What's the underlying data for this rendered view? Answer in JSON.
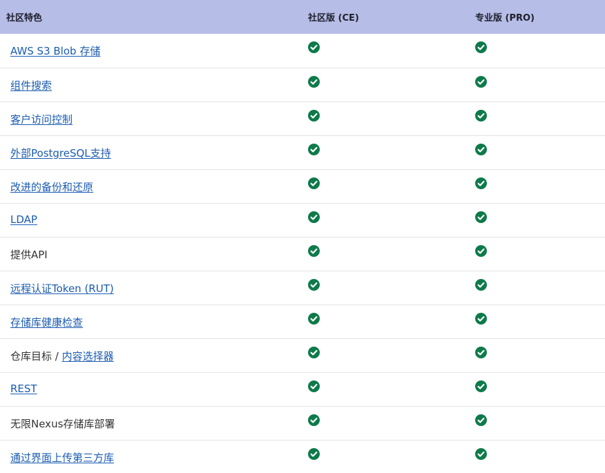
{
  "header": {
    "feature": "社区特色",
    "ce": "社区版 (CE)",
    "pro": "专业版 (PRO)"
  },
  "colors": {
    "header_bg": "#b6bde6",
    "link": "#1a5bb0",
    "check": "#0e7a4a"
  },
  "rows": [
    {
      "parts": [
        {
          "text": "AWS S3 Blob 存储",
          "link": true
        }
      ],
      "ce": "check-circle-icon",
      "pro": "check-circle-icon"
    },
    {
      "parts": [
        {
          "text": "组件搜索",
          "link": true
        }
      ],
      "ce": "check-circle-icon",
      "pro": "check-circle-icon"
    },
    {
      "parts": [
        {
          "text": "客户访问控制",
          "link": true
        }
      ],
      "ce": "check-circle-icon",
      "pro": "check-circle-icon"
    },
    {
      "parts": [
        {
          "text": "外部PostgreSQL支持",
          "link": true
        }
      ],
      "ce": "check-circle-icon",
      "pro": "check-circle-icon"
    },
    {
      "parts": [
        {
          "text": "改进的备份和还原",
          "link": true
        }
      ],
      "ce": "check-circle-icon",
      "pro": "check-circle-icon"
    },
    {
      "parts": [
        {
          "text": "LDAP",
          "link": true
        }
      ],
      "ce": "check-circle-icon",
      "pro": "check-circle-icon"
    },
    {
      "parts": [
        {
          "text": "提供API",
          "link": false
        }
      ],
      "ce": "check-circle-icon",
      "pro": "check-circle-icon"
    },
    {
      "parts": [
        {
          "text": "远程认证Token (RUT)",
          "link": true
        }
      ],
      "ce": "check-circle-icon",
      "pro": "check-circle-icon"
    },
    {
      "parts": [
        {
          "text": "存储库健康检查",
          "link": true
        }
      ],
      "ce": "check-circle-icon",
      "pro": "check-circle-icon"
    },
    {
      "parts": [
        {
          "text": "仓库目标 / ",
          "link": false
        },
        {
          "text": "内容选择器",
          "link": true
        }
      ],
      "ce": "check-circle-icon",
      "pro": "check-circle-icon"
    },
    {
      "parts": [
        {
          "text": "REST",
          "link": true
        }
      ],
      "ce": "check-circle-icon",
      "pro": "check-circle-icon"
    },
    {
      "parts": [
        {
          "text": "无限Nexus存储库部署",
          "link": false
        }
      ],
      "ce": "check-circle-icon",
      "pro": "check-circle-icon"
    },
    {
      "parts": [
        {
          "text": "通过界面上传第三方库",
          "link": true
        }
      ],
      "ce": "check-circle-icon",
      "pro": "check-circle-icon"
    }
  ]
}
